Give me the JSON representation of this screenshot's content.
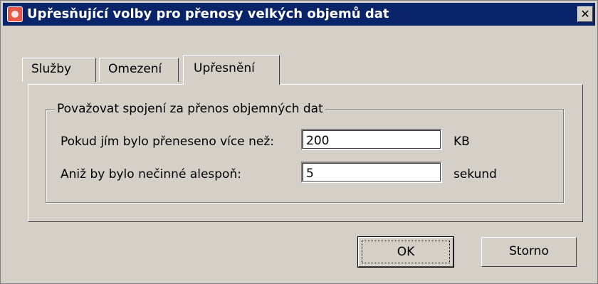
{
  "window": {
    "title": "Upřesňující volby pro přenosy velkých objemů dat",
    "close_label": "✕"
  },
  "tabs": [
    {
      "label": "Služby"
    },
    {
      "label": "Omezení"
    },
    {
      "label": "Upřesnění",
      "active": true
    }
  ],
  "group": {
    "legend": "Považovat spojení za přenos objemných dat",
    "rows": [
      {
        "label": "Pokud jím bylo přeneseno více než:",
        "value": "200",
        "unit": "KB"
      },
      {
        "label": "Aniž by bylo nečinné alespoň:",
        "value": "5",
        "unit": "sekund"
      }
    ]
  },
  "buttons": {
    "ok": "OK",
    "cancel": "Storno"
  }
}
